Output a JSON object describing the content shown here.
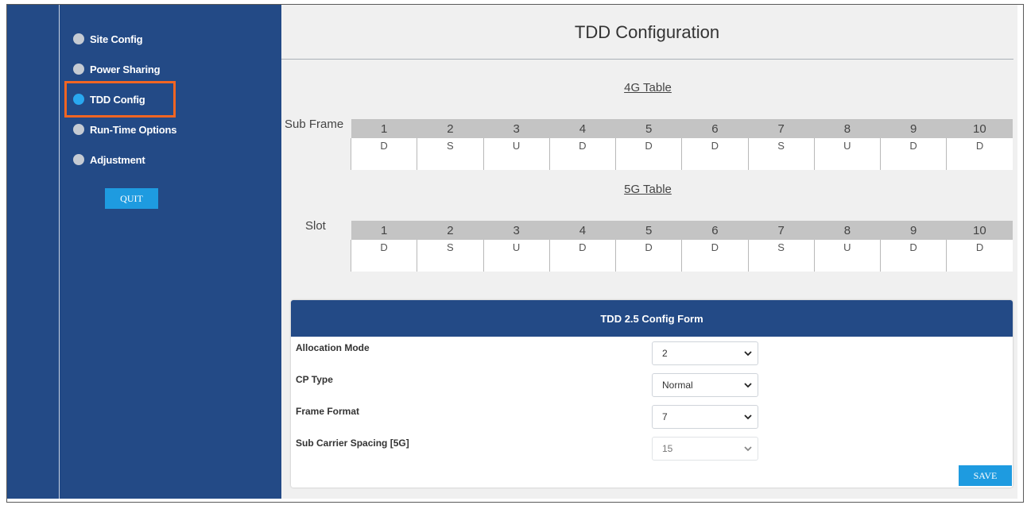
{
  "sidebar": {
    "items": [
      {
        "label": "Site Config",
        "active": false
      },
      {
        "label": "Power Sharing",
        "active": false
      },
      {
        "label": "TDD Config",
        "active": true
      },
      {
        "label": "Run-Time Options",
        "active": false
      },
      {
        "label": "Adjustment",
        "active": false
      }
    ],
    "quit_label": "QUIT"
  },
  "main": {
    "title": "TDD Configuration",
    "table_4g": {
      "caption": "4G Table",
      "row_label": "Sub Frame",
      "headers": [
        "1",
        "2",
        "3",
        "4",
        "5",
        "6",
        "7",
        "8",
        "9",
        "10"
      ],
      "values": [
        "D",
        "S",
        "U",
        "D",
        "D",
        "D",
        "S",
        "U",
        "D",
        "D"
      ]
    },
    "table_5g": {
      "caption": "5G Table",
      "row_label": "Slot",
      "headers": [
        "1",
        "2",
        "3",
        "4",
        "5",
        "6",
        "7",
        "8",
        "9",
        "10"
      ],
      "values": [
        "D",
        "S",
        "U",
        "D",
        "D",
        "D",
        "S",
        "U",
        "D",
        "D"
      ]
    }
  },
  "form": {
    "title": "TDD 2.5 Config Form",
    "fields": [
      {
        "label": "Allocation Mode",
        "value": "2",
        "disabled": false
      },
      {
        "label": "CP Type",
        "value": "Normal",
        "disabled": false
      },
      {
        "label": "Frame Format",
        "value": "7",
        "disabled": false
      },
      {
        "label": "Sub Carrier Spacing [5G]",
        "value": "15",
        "disabled": true
      }
    ],
    "save_label": "SAVE"
  },
  "colors": {
    "sidebar_bg": "#234a86",
    "accent_button": "#1e9be0",
    "active_dot": "#29a8f0",
    "highlight_box": "#f26522"
  }
}
